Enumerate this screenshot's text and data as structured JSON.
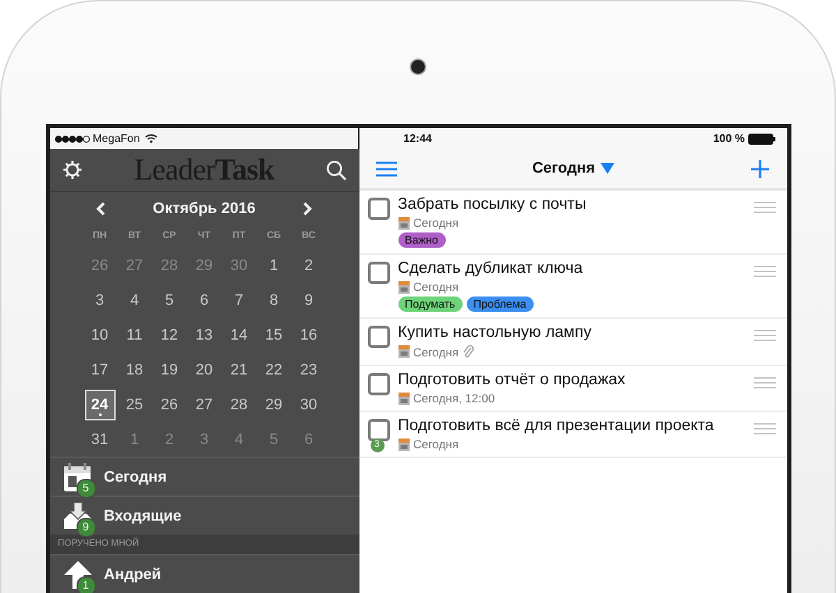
{
  "status_bar": {
    "carrier": "MegaFon",
    "time": "12:44",
    "battery": "100 %"
  },
  "sidebar": {
    "logo": {
      "light": "Leader",
      "bold": "Task"
    },
    "calendar": {
      "month": "Октябрь 2016",
      "weekdays": [
        "ПН",
        "ВТ",
        "СР",
        "ЧТ",
        "ПТ",
        "СБ",
        "ВС"
      ],
      "days": [
        {
          "day": "26",
          "in_month": false,
          "selected": false,
          "marked": false
        },
        {
          "day": "27",
          "in_month": false,
          "selected": false,
          "marked": false
        },
        {
          "day": "28",
          "in_month": false,
          "selected": false,
          "marked": false
        },
        {
          "day": "29",
          "in_month": false,
          "selected": false,
          "marked": false
        },
        {
          "day": "30",
          "in_month": false,
          "selected": false,
          "marked": false
        },
        {
          "day": "1",
          "in_month": true,
          "selected": false,
          "marked": false
        },
        {
          "day": "2",
          "in_month": true,
          "selected": false,
          "marked": false
        },
        {
          "day": "3",
          "in_month": true,
          "selected": false,
          "marked": false
        },
        {
          "day": "4",
          "in_month": true,
          "selected": false,
          "marked": false
        },
        {
          "day": "5",
          "in_month": true,
          "selected": false,
          "marked": false
        },
        {
          "day": "6",
          "in_month": true,
          "selected": false,
          "marked": false
        },
        {
          "day": "7",
          "in_month": true,
          "selected": false,
          "marked": false
        },
        {
          "day": "8",
          "in_month": true,
          "selected": false,
          "marked": false
        },
        {
          "day": "9",
          "in_month": true,
          "selected": false,
          "marked": false
        },
        {
          "day": "10",
          "in_month": true,
          "selected": false,
          "marked": false
        },
        {
          "day": "11",
          "in_month": true,
          "selected": false,
          "marked": false
        },
        {
          "day": "12",
          "in_month": true,
          "selected": false,
          "marked": false
        },
        {
          "day": "13",
          "in_month": true,
          "selected": false,
          "marked": false
        },
        {
          "day": "14",
          "in_month": true,
          "selected": false,
          "marked": false
        },
        {
          "day": "15",
          "in_month": true,
          "selected": false,
          "marked": false
        },
        {
          "day": "16",
          "in_month": true,
          "selected": false,
          "marked": false
        },
        {
          "day": "17",
          "in_month": true,
          "selected": false,
          "marked": false
        },
        {
          "day": "18",
          "in_month": true,
          "selected": false,
          "marked": false
        },
        {
          "day": "19",
          "in_month": true,
          "selected": false,
          "marked": false
        },
        {
          "day": "20",
          "in_month": true,
          "selected": false,
          "marked": false
        },
        {
          "day": "21",
          "in_month": true,
          "selected": false,
          "marked": false
        },
        {
          "day": "22",
          "in_month": true,
          "selected": false,
          "marked": false
        },
        {
          "day": "23",
          "in_month": true,
          "selected": false,
          "marked": false
        },
        {
          "day": "24",
          "in_month": true,
          "selected": true,
          "marked": true
        },
        {
          "day": "25",
          "in_month": true,
          "selected": false,
          "marked": false
        },
        {
          "day": "26",
          "in_month": true,
          "selected": false,
          "marked": false
        },
        {
          "day": "27",
          "in_month": true,
          "selected": false,
          "marked": false
        },
        {
          "day": "28",
          "in_month": true,
          "selected": false,
          "marked": false
        },
        {
          "day": "29",
          "in_month": true,
          "selected": false,
          "marked": false
        },
        {
          "day": "30",
          "in_month": true,
          "selected": false,
          "marked": false
        },
        {
          "day": "31",
          "in_month": true,
          "selected": false,
          "marked": false
        },
        {
          "day": "1",
          "in_month": false,
          "selected": false,
          "marked": false
        },
        {
          "day": "2",
          "in_month": false,
          "selected": false,
          "marked": false
        },
        {
          "day": "3",
          "in_month": false,
          "selected": false,
          "marked": false
        },
        {
          "day": "4",
          "in_month": false,
          "selected": false,
          "marked": false
        },
        {
          "day": "5",
          "in_month": false,
          "selected": false,
          "marked": false
        },
        {
          "day": "6",
          "in_month": false,
          "selected": false,
          "marked": false
        }
      ]
    },
    "menu": [
      {
        "kind": "today",
        "label": "Сегодня",
        "badge": "5"
      },
      {
        "kind": "inbox",
        "label": "Входящие",
        "badge": "9"
      },
      {
        "kind": "header",
        "label": "ПОРУЧЕНО МНОЙ"
      },
      {
        "kind": "person",
        "label": "Андрей",
        "badge": "1"
      }
    ]
  },
  "main": {
    "title": "Сегодня",
    "tasks": [
      {
        "title": "Забрать посылку с почты",
        "date": "Сегодня",
        "checked": false,
        "attachment": false,
        "tags": [
          {
            "label": "Важно",
            "color": "#b05ec8"
          }
        ]
      },
      {
        "title": "Сделать дубликат ключа",
        "date": "Сегодня",
        "checked": false,
        "attachment": false,
        "tags": [
          {
            "label": "Подумать",
            "color": "#6ed47a"
          },
          {
            "label": "Проблема",
            "color": "#3a8ff0"
          }
        ]
      },
      {
        "title": "Купить настольную лампу",
        "date": "Сегодня",
        "checked": false,
        "attachment": true
      },
      {
        "title": "Подготовить отчёт о продажах",
        "date": "Сегодня, 12:00",
        "checked": false,
        "attachment": false
      },
      {
        "title": "Подготовить всё для презентации проекта",
        "date": "Сегодня",
        "checked": false,
        "attachment": false,
        "badge": "3"
      }
    ]
  }
}
